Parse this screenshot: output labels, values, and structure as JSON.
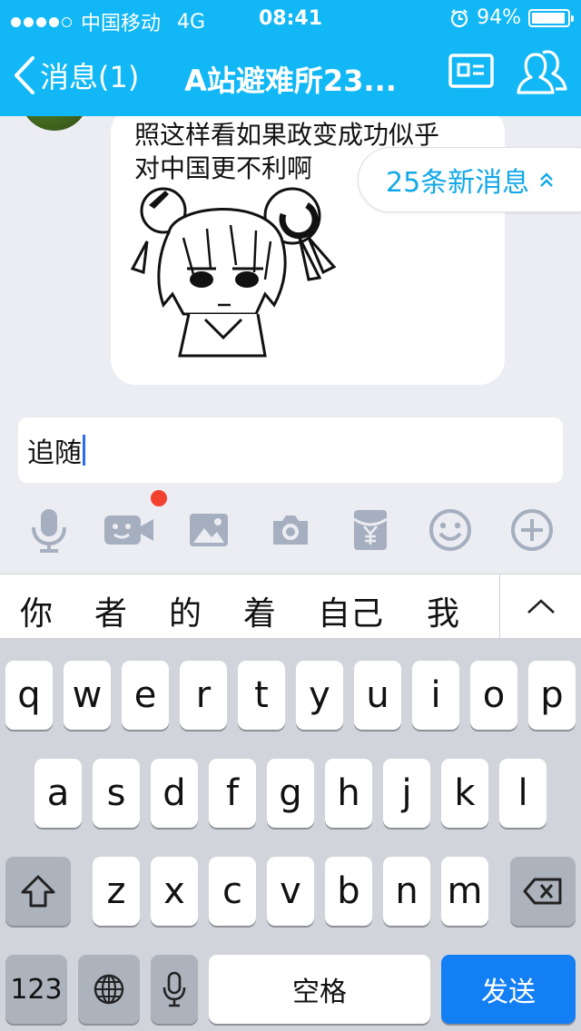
{
  "status_bar": {
    "carrier": "中国移动",
    "network": "4G",
    "time": "08:41",
    "battery": "94%",
    "battery_level": 0.94
  },
  "nav": {
    "back_label": "消息(1)",
    "title": "A站避难所23...",
    "card_icon": "contact-card-icon",
    "group_icon": "group-members-icon"
  },
  "chat": {
    "message_text_line1": "照这样看如果政变成功似乎",
    "message_text_line2": "对中国更不利啊",
    "new_messages_label": "25条新消息"
  },
  "input": {
    "value": "追随"
  },
  "toolbar_icons": [
    "microphone-icon",
    "video-call-icon",
    "image-icon",
    "camera-icon",
    "red-packet-icon",
    "emoji-icon",
    "plus-icon"
  ],
  "candidates": [
    "你",
    "者",
    "的",
    "着",
    "自己",
    "我"
  ],
  "keyboard": {
    "row1": [
      "q",
      "w",
      "e",
      "r",
      "t",
      "y",
      "u",
      "i",
      "o",
      "p"
    ],
    "row2": [
      "a",
      "s",
      "d",
      "f",
      "g",
      "h",
      "j",
      "k",
      "l"
    ],
    "row3": [
      "z",
      "x",
      "c",
      "v",
      "b",
      "n",
      "m"
    ],
    "num_label": "123",
    "space_label": "空格",
    "send_label": "发送"
  },
  "colors": {
    "accent": "#12b7f5",
    "send": "#137ff5",
    "notification": "#f2412e"
  }
}
